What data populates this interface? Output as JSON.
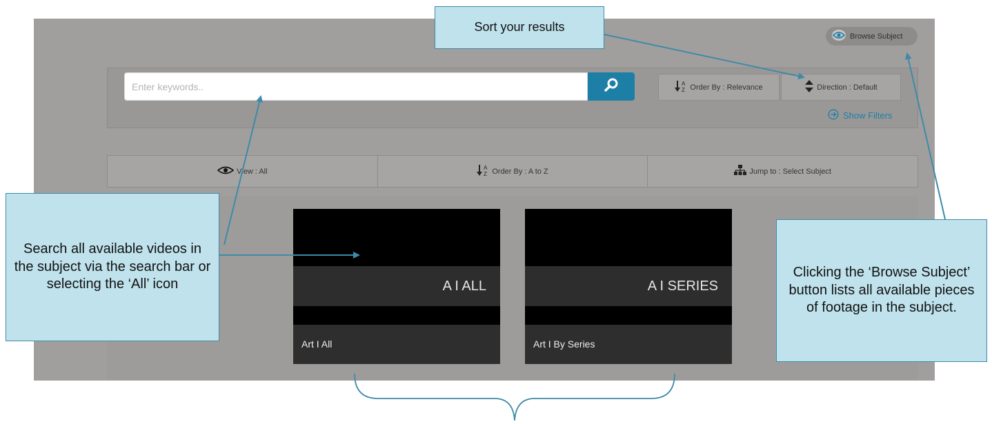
{
  "header": {
    "browse_label": "Browse Subject"
  },
  "search": {
    "placeholder": "Enter keywords.."
  },
  "sort": {
    "order_label": "Order By : Relevance",
    "direction_label": "Direction : Default"
  },
  "filters": {
    "show_label": "Show Filters"
  },
  "toolbar": {
    "view_label": "View : All",
    "order_label": "Order By : A to Z",
    "jump_label": "Jump to : Select Subject"
  },
  "cards": [
    {
      "band": "A I ALL",
      "caption": "Art I All"
    },
    {
      "band": "A I SERIES",
      "caption": "Art I By Series"
    }
  ],
  "callouts": {
    "sort": "Sort your results",
    "search": "Search all available videos in the subject via the search bar or selecting the ‘All’ icon",
    "browse": "Clicking the ‘Browse Subject’ button lists all available pieces of footage in the subject."
  },
  "colors": {
    "accent": "#1e7fa6",
    "callout_fill": "#bfe2ec",
    "callout_border": "#3e8aa8"
  }
}
